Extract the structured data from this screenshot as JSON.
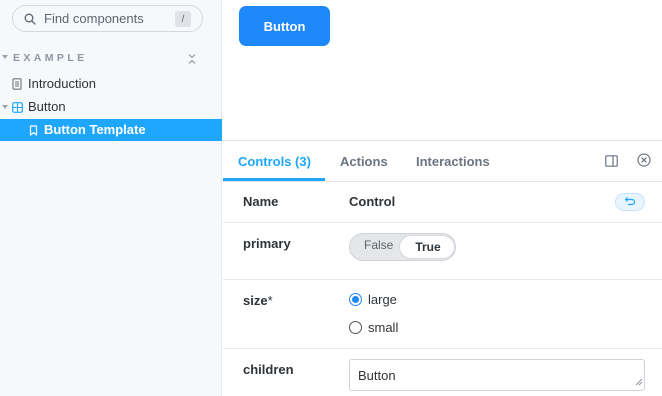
{
  "sidebar": {
    "search": {
      "placeholder": "Find components",
      "shortcut": "/",
      "icon": "search-icon"
    },
    "section_title": "EXAMPLE",
    "collapse_icon": "collapse-all-icon",
    "items": [
      {
        "label": "Introduction",
        "icon": "document-icon",
        "selected": false
      },
      {
        "label": "Button",
        "icon": "component-icon",
        "selected": false,
        "expanded": true
      },
      {
        "label": "Button Template",
        "icon": "bookmark-icon",
        "selected": true
      }
    ]
  },
  "canvas": {
    "button_label": "Button",
    "button_color": "#1e88f8"
  },
  "panel": {
    "tabs": [
      {
        "label": "Controls (3)",
        "active": true
      },
      {
        "label": "Actions",
        "active": false
      },
      {
        "label": "Interactions",
        "active": false
      }
    ],
    "icons": [
      "panel-orientation-icon",
      "close-icon"
    ],
    "accent_color": "#1ea7fd",
    "table": {
      "header_name": "Name",
      "header_control": "Control",
      "reset_icon": "undo-icon",
      "rows": {
        "primary": {
          "name": "primary",
          "options": [
            "False",
            "True"
          ],
          "selected": "True"
        },
        "size": {
          "name": "size",
          "required_mark": "*",
          "options": [
            "large",
            "small"
          ],
          "selected": "large"
        },
        "children": {
          "name": "children",
          "value": "Button"
        }
      }
    }
  }
}
